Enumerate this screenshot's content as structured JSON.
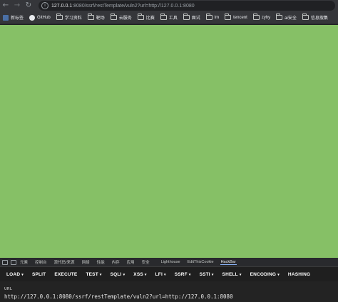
{
  "address_bar": {
    "url_host": "127.0.0.1",
    "url_rest": ":8080/ssrf/restTemplate/vuln2?url=http://127.0.0.1:8080"
  },
  "bookmarks": [
    {
      "label": "新标签",
      "icon": "site-icon"
    },
    {
      "label": "GitHub",
      "icon": "github-icon"
    },
    {
      "label": "学习资料",
      "icon": "folder-icon"
    },
    {
      "label": "靶场",
      "icon": "folder-icon"
    },
    {
      "label": "云服务",
      "icon": "folder-icon"
    },
    {
      "label": "比赛",
      "icon": "folder-icon"
    },
    {
      "label": "工具",
      "icon": "folder-icon"
    },
    {
      "label": "面试",
      "icon": "folder-icon"
    },
    {
      "label": "lm",
      "icon": "folder-icon"
    },
    {
      "label": "tencent",
      "icon": "folder-icon"
    },
    {
      "label": "zyhy",
      "icon": "folder-icon"
    },
    {
      "label": "ai安全",
      "icon": "folder-icon"
    },
    {
      "label": "信息搜集",
      "icon": "folder-icon"
    }
  ],
  "page": {
    "background_color": "#86c066"
  },
  "devtools": {
    "tabs": [
      "元素",
      "控制台",
      "源代码/来源",
      "网络",
      "性能",
      "内存",
      "应用",
      "安全",
      "Lighthouse",
      "EditThisCookie",
      "HackBar"
    ],
    "active_tab": "HackBar",
    "hackbar": {
      "buttons": [
        {
          "label": "LOAD",
          "caret": true
        },
        {
          "label": "SPLIT",
          "caret": false
        },
        {
          "label": "EXECUTE",
          "caret": false
        },
        {
          "label": "TEST",
          "caret": true
        },
        {
          "label": "SQLI",
          "caret": true
        },
        {
          "label": "XSS",
          "caret": true
        },
        {
          "label": "LFI",
          "caret": true
        },
        {
          "label": "SSRF",
          "caret": true
        },
        {
          "label": "SSTI",
          "caret": true
        },
        {
          "label": "SHELL",
          "caret": true
        },
        {
          "label": "ENCODING",
          "caret": true
        },
        {
          "label": "HASHING",
          "caret": false
        }
      ],
      "url_label": "URL",
      "url_value": "http://127.0.0.1:8080/ssrf/restTemplate/vuln2?url=http://127.0.0.1:8080"
    }
  }
}
